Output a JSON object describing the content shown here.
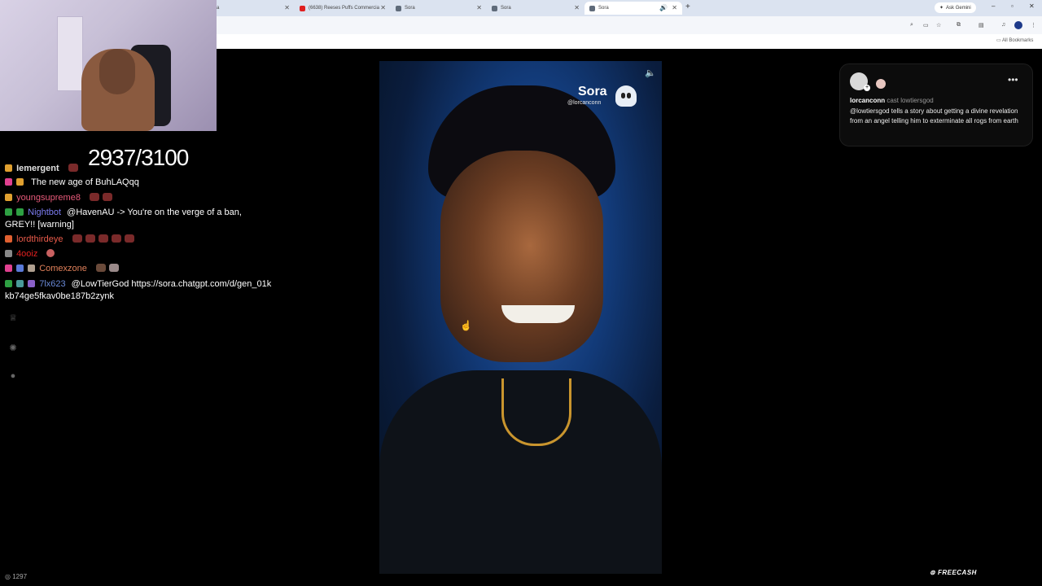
{
  "browser": {
    "tabs": [
      {
        "label": "ra",
        "icon": "tab-favicon",
        "active": false
      },
      {
        "label": "(6638) Reeses Puffs Commercia",
        "icon": "youtube-icon",
        "active": false
      },
      {
        "label": "Sora",
        "icon": "sora-favicon",
        "active": false
      },
      {
        "label": "Sora",
        "icon": "sora-favicon",
        "active": false
      },
      {
        "label": "Sora",
        "icon": "sora-favicon",
        "active": true
      }
    ],
    "ask_gemini": "Ask Gemini",
    "all_bookmarks": "All Bookmarks"
  },
  "stream": {
    "sub_counter": "2937/3100",
    "viewer_count": "1297",
    "brand": "FREECASH"
  },
  "chat": {
    "messages": [
      {
        "user": "Iemergent",
        "user_color": "#e0e0e0",
        "text": ""
      },
      {
        "user": "",
        "user_color": "#1e2b9a",
        "text": "The new age of BuhLAQqq"
      },
      {
        "user": "youngsupreme8",
        "user_color": "#e85a7a",
        "text": ""
      },
      {
        "user": "Nightbot",
        "user_color": "#7c7cf0",
        "text": "@HavenAU -> You're on the verge of a ban, GREY!! [warning]"
      },
      {
        "user": "lordthirdeye",
        "user_color": "#e85a4a",
        "text": ""
      },
      {
        "user": "4ooiz",
        "user_color": "#e02020",
        "text": ""
      },
      {
        "user": "Comexzone",
        "user_color": "#e0805a",
        "text": ""
      },
      {
        "user": "7lx623",
        "user_color": "#6a8ad8",
        "text": "@LowTierGod https://sora.chatgpt.com/d/gen_01kkb74ge5fkav0be187b2zynk"
      }
    ]
  },
  "video": {
    "watermark": "Sora",
    "handle": "@lorcanconn"
  },
  "post": {
    "author": "lorcanconn",
    "cast_label": "cast lowtiersgod",
    "text": "@lowtiersgod tells a story about getting a divine revelation from an angel telling him to exterminate all rogs from earth"
  }
}
